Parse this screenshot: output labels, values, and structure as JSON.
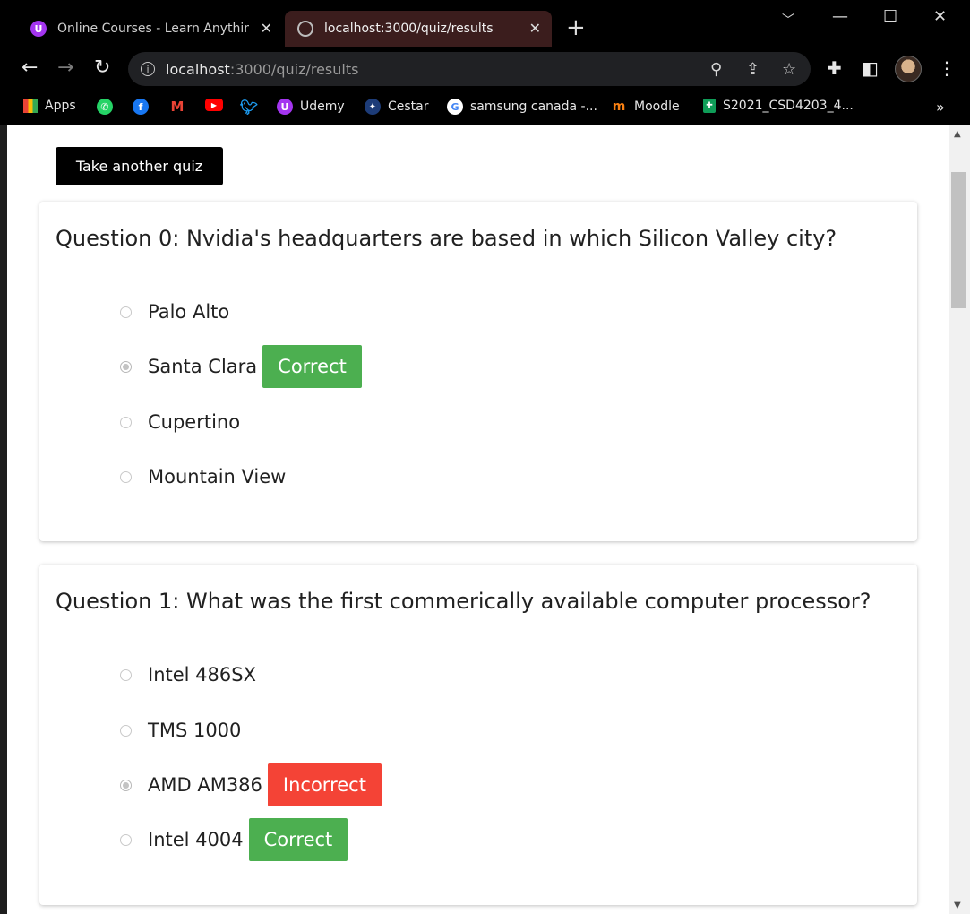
{
  "browser": {
    "tabs": [
      {
        "title": "Online Courses - Learn Anything,",
        "favicon": "udemy-icon"
      },
      {
        "title": "localhost:3000/quiz/results",
        "favicon": "globe-icon"
      }
    ],
    "url_host": "localhost",
    "url_rest": ":3000/quiz/results",
    "bookmarks": [
      {
        "label": "Apps",
        "icon": "apps-grid-icon"
      },
      {
        "label": "",
        "icon": "whatsapp-icon"
      },
      {
        "label": "",
        "icon": "facebook-icon"
      },
      {
        "label": "",
        "icon": "gmail-icon"
      },
      {
        "label": "",
        "icon": "youtube-icon"
      },
      {
        "label": "",
        "icon": "twitter-icon"
      },
      {
        "label": "Udemy",
        "icon": "udemy-icon"
      },
      {
        "label": "Cestar",
        "icon": "cestar-icon"
      },
      {
        "label": "samsung canada -...",
        "icon": "google-icon"
      },
      {
        "label": "Moodle",
        "icon": "moodle-icon"
      },
      {
        "label": "S2021_CSD4203_4...",
        "icon": "sheet-icon"
      }
    ]
  },
  "page": {
    "take_another_label": "Take another quiz",
    "questions": [
      {
        "title": "Question 0: Nvidia's headquarters are based in which Silicon Valley city?",
        "options": [
          {
            "label": "Palo Alto",
            "checked": false,
            "badge": ""
          },
          {
            "label": "Santa Clara",
            "checked": true,
            "badge": "Correct"
          },
          {
            "label": "Cupertino",
            "checked": false,
            "badge": ""
          },
          {
            "label": "Mountain View",
            "checked": false,
            "badge": ""
          }
        ]
      },
      {
        "title": "Question 1: What was the first commerically available computer processor?",
        "options": [
          {
            "label": "Intel 486SX",
            "checked": false,
            "badge": ""
          },
          {
            "label": "TMS 1000",
            "checked": false,
            "badge": ""
          },
          {
            "label": "AMD AM386",
            "checked": true,
            "badge": "Incorrect"
          },
          {
            "label": "Intel 4004",
            "checked": false,
            "badge": "Correct"
          }
        ]
      }
    ]
  },
  "colors": {
    "correct": "#4caf50",
    "incorrect": "#f44336"
  }
}
